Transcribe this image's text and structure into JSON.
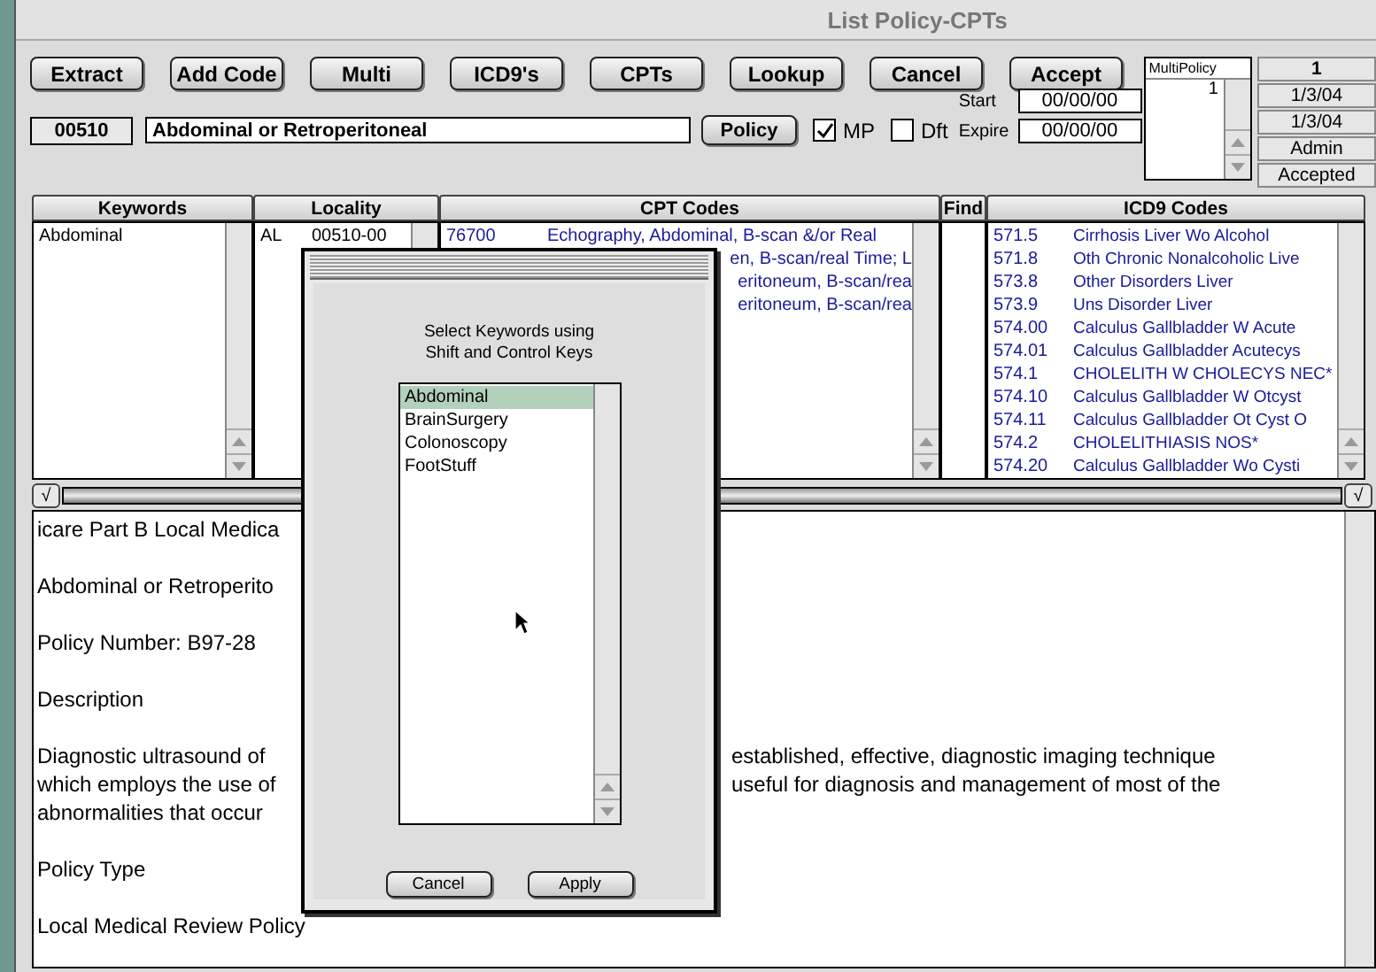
{
  "window": {
    "title": "List Policy-CPTs"
  },
  "toolbar": [
    "Extract",
    "Add Code",
    "Multi",
    "ICD9's",
    "CPTs",
    "Lookup",
    "Cancel",
    "Accept"
  ],
  "multi_policy": {
    "label": "MultiPolicy",
    "items": [
      "1"
    ]
  },
  "status": [
    "1",
    "1/3/04",
    "1/3/04",
    "Admin",
    "Accepted"
  ],
  "policy": {
    "code": "00510",
    "title": "Abdominal or Retroperitoneal",
    "button": "Policy"
  },
  "options": [
    {
      "label": "MP",
      "checked": true
    },
    {
      "label": "Dft",
      "checked": false
    }
  ],
  "dates": [
    {
      "label": "Start",
      "value": "00/00/00"
    },
    {
      "label": "Expire",
      "value": "00/00/00"
    }
  ],
  "table": {
    "columns": [
      "Keywords",
      "Locality",
      "CPT Codes",
      "Find",
      "ICD9 Codes"
    ],
    "keywords": [
      "Abdominal"
    ],
    "locality": [
      {
        "state": "AL",
        "code": "00510-00"
      }
    ],
    "cpt": [
      {
        "kind": "full",
        "code": "76700",
        "description": "Echography, Abdominal, B-scan &/or Real"
      },
      {
        "kind": "partial",
        "text": "en, B-scan/real Time; L"
      },
      {
        "kind": "partial",
        "text": "eritoneum, B-scan/rea"
      },
      {
        "kind": "partial",
        "text": "eritoneum, B-scan/rea"
      }
    ],
    "icd9": [
      {
        "code": "571.5",
        "description": "Cirrhosis Liver Wo Alcohol"
      },
      {
        "code": "571.8",
        "description": "Oth Chronic Nonalcoholic Live"
      },
      {
        "code": "573.8",
        "description": "Other Disorders Liver"
      },
      {
        "code": "573.9",
        "description": "Uns Disorder Liver"
      },
      {
        "code": "574.00",
        "description": "Calculus Gallbladder W Acute"
      },
      {
        "code": "574.01",
        "description": "Calculus Gallbladder Acutecys"
      },
      {
        "code": "574.1",
        "description": "CHOLELITH W CHOLECYS NEC*"
      },
      {
        "code": "574.10",
        "description": "Calculus Gallbladder W Otcyst"
      },
      {
        "code": "574.11",
        "description": "Calculus Gallbladder Ot Cyst O"
      },
      {
        "code": "574.2",
        "description": "CHOLELITHIASIS NOS*"
      },
      {
        "code": "574.20",
        "description": "Calculus Gallbladder Wo Cysti"
      }
    ]
  },
  "splitter": {
    "left": "√",
    "right": "√"
  },
  "text": {
    "paragraphs": [
      {
        "lines": [
          {
            "left": "icare Part B Local Medica"
          }
        ]
      },
      {
        "lines": [
          {
            "left": "Abdominal or Retroperito"
          }
        ]
      },
      {
        "lines": [
          {
            "left": "Policy Number: B97-28"
          }
        ]
      },
      {
        "lines": [
          {
            "left": "Description"
          }
        ]
      },
      {
        "lines": [
          {
            "left": "Diagnostic ultrasound of",
            "right": "established, effective, diagnostic imaging technique"
          },
          {
            "left": "which employs the use of",
            "right": "useful for diagnosis and management of most of the"
          },
          {
            "left": "abnormalities that occur"
          }
        ]
      },
      {
        "lines": [
          {
            "left": "Policy Type"
          }
        ]
      },
      {
        "lines": [
          {
            "left": "Local Medical Review Policy"
          }
        ]
      }
    ]
  },
  "dialog": {
    "prompt": [
      "Select Keywords using",
      "Shift and Control Keys"
    ],
    "items": [
      {
        "label": "Abdominal",
        "selected": true
      },
      {
        "label": "BrainSurgery",
        "selected": false
      },
      {
        "label": "Colonoscopy",
        "selected": false
      },
      {
        "label": "FootStuff",
        "selected": false
      }
    ],
    "buttons": [
      "Cancel",
      "Apply"
    ]
  }
}
